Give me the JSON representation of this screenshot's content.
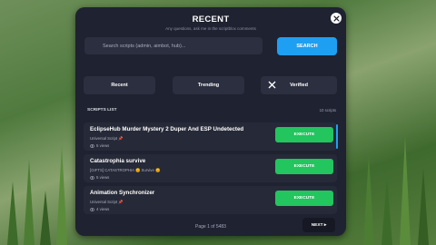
{
  "header": {
    "title": "RECENT",
    "subtitle": "Any questions, ask me in the scriptblox comments"
  },
  "search": {
    "placeholder": "Search scripts (admin, aimbot, hub)...",
    "value": "",
    "button_label": "SEARCH"
  },
  "filters": {
    "recent": "Recent",
    "trending": "Trending",
    "verified": "Verified"
  },
  "list": {
    "title": "SCRIPTS LIST",
    "count": "10 scripts"
  },
  "scripts": [
    {
      "name": "EclipseHub Murder Mystery 2 Duper And ESP Undetected",
      "game": "Universal Script 📌",
      "views": "5 views",
      "execute_label": "EXECUTE"
    },
    {
      "name": "Catastrophia survive",
      "game": "[GIFTS] CATASTROPHIA 🌞 Survive 🌞",
      "views": "5 views",
      "execute_label": "EXECUTE"
    },
    {
      "name": "Animation Synchronizer",
      "game": "Universal Script 📌",
      "views": "4 views",
      "execute_label": "EXECUTE"
    }
  ],
  "pagination": {
    "label": "Page 1 of 5483",
    "next_label": "NEXT ▸"
  },
  "colors": {
    "panel": "#1f2230",
    "accent": "#1e9ff2",
    "execute": "#22c55e"
  }
}
